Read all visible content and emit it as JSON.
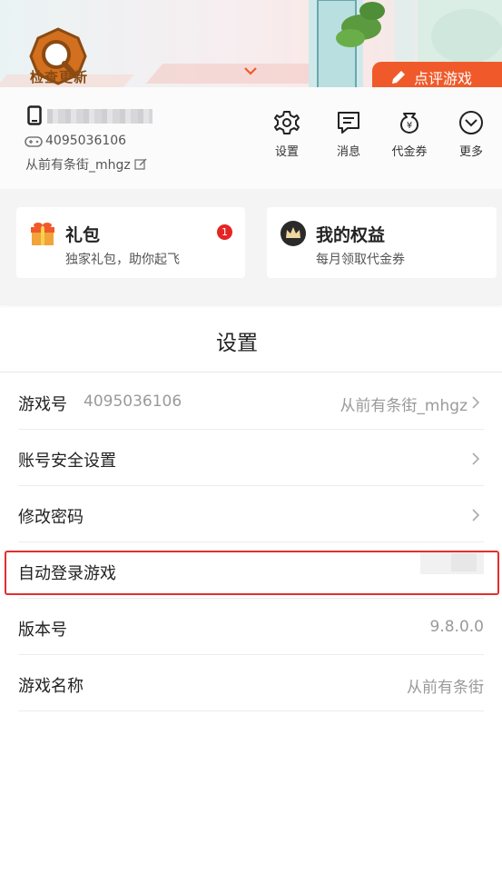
{
  "banner": {
    "update_label": "检查更新",
    "review_button": "点评游戏"
  },
  "profile": {
    "user_id": "4095036106",
    "nickname": "从前有条街_mhgz"
  },
  "top_actions": [
    {
      "label": "设置",
      "icon": "gear-icon"
    },
    {
      "label": "消息",
      "icon": "message-icon"
    },
    {
      "label": "代金券",
      "icon": "voucher-icon"
    },
    {
      "label": "更多",
      "icon": "more-icon"
    }
  ],
  "cards": {
    "gift": {
      "title": "礼包",
      "subtitle": "独家礼包，助你起飞",
      "badge": "1"
    },
    "rights": {
      "title": "我的权益",
      "subtitle": "每月领取代金券"
    }
  },
  "settings": {
    "title": "设置",
    "rows": [
      {
        "label": "游戏号",
        "sub_value": "4095036106",
        "value": "从前有条街_mhgz"
      },
      {
        "label": "账号安全设置"
      },
      {
        "label": "修改密码"
      },
      {
        "label": "自动登录游戏"
      },
      {
        "label": "版本号",
        "value": "9.8.0.0"
      },
      {
        "label": "游戏名称",
        "value": "从前有条街"
      }
    ]
  },
  "colors": {
    "accent": "#f05a2a",
    "highlight": "#e22f2f",
    "badge": "#e52424"
  }
}
